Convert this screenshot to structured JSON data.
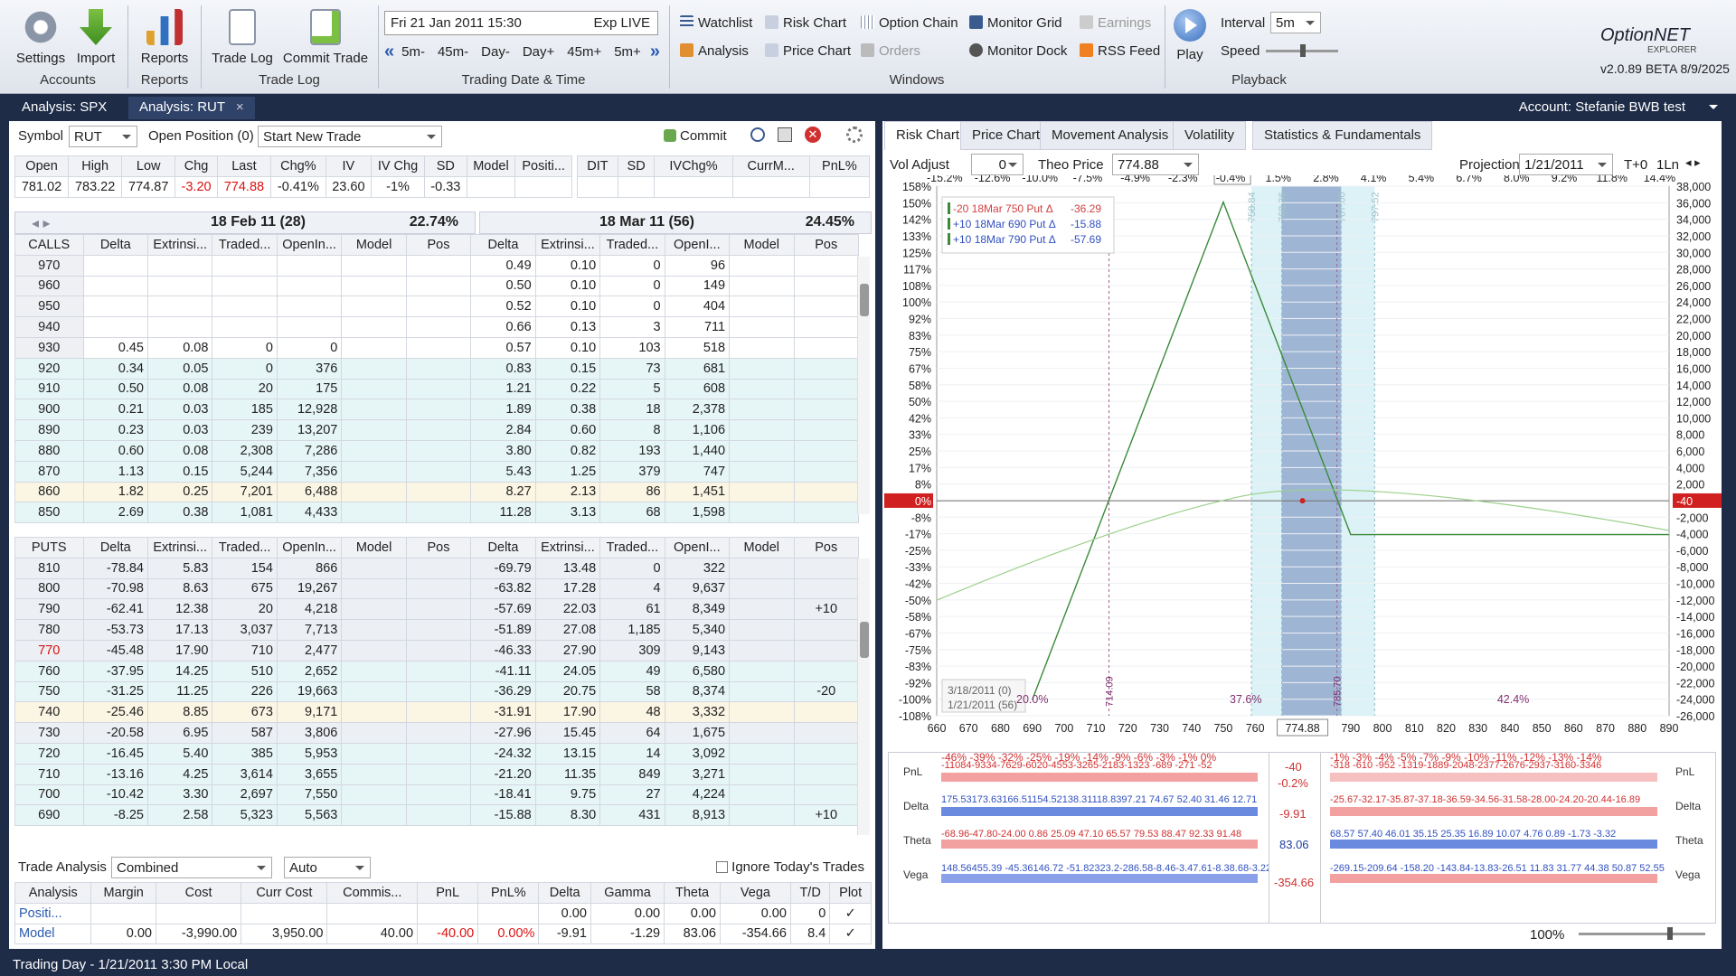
{
  "ribbon": {
    "settings": "Settings",
    "import": "Import",
    "reports": "Reports",
    "trade_log": "Trade Log",
    "commit_trade": "Commit Trade",
    "groups": {
      "accounts": "Accounts",
      "reports": "Reports",
      "trade_log": "Trade Log",
      "trading_date": "Trading Date & Time",
      "windows": "Windows",
      "playback": "Playback"
    },
    "date": "Fri 21 Jan 2011 15:30",
    "exp": "Exp LIVE",
    "nav": [
      "5m-",
      "45m-",
      "Day-",
      "Day+",
      "45m+",
      "5m+"
    ],
    "windows": {
      "watchlist": "Watchlist",
      "risk_chart": "Risk Chart",
      "option_chain": "Option Chain",
      "monitor_grid": "Monitor Grid",
      "earnings": "Earnings",
      "analysis": "Analysis",
      "price_chart": "Price Chart",
      "orders": "Orders",
      "monitor_dock": "Monitor Dock",
      "rss_feed": "RSS Feed"
    },
    "play": "Play",
    "interval_label": "Interval",
    "interval": "5m",
    "speed_label": "Speed",
    "logo": "OptionNET",
    "logo_sub": "EXPLORER",
    "version": "v2.0.89 BETA 8/9/2025"
  },
  "tabs": [
    {
      "label": "Analysis: SPX"
    },
    {
      "label": "Analysis: RUT",
      "close": "×"
    }
  ],
  "account": "Account: Stefanie BWB test",
  "symbol": {
    "label": "Symbol",
    "value": "RUT",
    "open_position": "Open Position (0)",
    "trade": "Start New Trade",
    "commit": "Commit"
  },
  "quote": {
    "headers": [
      "Open",
      "High",
      "Low",
      "Chg",
      "Last",
      "Chg%",
      "IV",
      "IV Chg",
      "SD",
      "Model",
      "Positi..."
    ],
    "values": [
      "781.02",
      "783.22",
      "774.87",
      "-3.20",
      "774.88",
      "-0.41%",
      "23.60",
      "-1%",
      "-0.33",
      "",
      ""
    ],
    "pos_headers": [
      "DIT",
      "SD",
      "IVChg%",
      "CurrM...",
      "PnL%"
    ]
  },
  "chain": {
    "exp1": {
      "title": "18 Feb 11 (28)",
      "iv": "22.74%"
    },
    "exp2": {
      "title": "18 Mar 11 (56)",
      "iv": "24.45%"
    },
    "cols": [
      "Delta",
      "Extrinsi...",
      "Traded...",
      "OpenIn...",
      "Model",
      "Pos"
    ],
    "cols2": [
      "Delta",
      "Extrinsi...",
      "Traded...",
      "OpenI...",
      "Model",
      "Pos"
    ],
    "calls_label": "CALLS",
    "puts_label": "PUTS",
    "calls": [
      [
        "970",
        "",
        "",
        "",
        "",
        "",
        "",
        "0.49",
        "0.10",
        "0",
        "96",
        "",
        ""
      ],
      [
        "960",
        "",
        "",
        "",
        "",
        "",
        "",
        "0.50",
        "0.10",
        "0",
        "149",
        "",
        ""
      ],
      [
        "950",
        "",
        "",
        "",
        "",
        "",
        "",
        "0.52",
        "0.10",
        "0",
        "404",
        "",
        ""
      ],
      [
        "940",
        "",
        "",
        "",
        "",
        "",
        "",
        "0.66",
        "0.13",
        "3",
        "711",
        "",
        ""
      ],
      [
        "930",
        "0.45",
        "0.08",
        "0",
        "0",
        "",
        "",
        "0.57",
        "0.10",
        "103",
        "518",
        "",
        ""
      ],
      [
        "920",
        "0.34",
        "0.05",
        "0",
        "376",
        "",
        "",
        "0.83",
        "0.15",
        "73",
        "681",
        "",
        ""
      ],
      [
        "910",
        "0.50",
        "0.08",
        "20",
        "175",
        "",
        "",
        "1.21",
        "0.22",
        "5",
        "608",
        "",
        ""
      ],
      [
        "900",
        "0.21",
        "0.03",
        "185",
        "12,928",
        "",
        "",
        "1.89",
        "0.38",
        "18",
        "2,378",
        "",
        ""
      ],
      [
        "890",
        "0.23",
        "0.03",
        "239",
        "13,207",
        "",
        "",
        "2.84",
        "0.60",
        "8",
        "1,106",
        "",
        ""
      ],
      [
        "880",
        "0.60",
        "0.08",
        "2,308",
        "7,286",
        "",
        "",
        "3.80",
        "0.82",
        "193",
        "1,440",
        "",
        ""
      ],
      [
        "870",
        "1.13",
        "0.15",
        "5,244",
        "7,356",
        "",
        "",
        "5.43",
        "1.25",
        "379",
        "747",
        "",
        ""
      ],
      [
        "860",
        "1.82",
        "0.25",
        "7,201",
        "6,488",
        "",
        "",
        "8.27",
        "2.13",
        "86",
        "1,451",
        "",
        ""
      ],
      [
        "850",
        "2.69",
        "0.38",
        "1,081",
        "4,433",
        "",
        "",
        "11.28",
        "3.13",
        "68",
        "1,598",
        "",
        ""
      ]
    ],
    "puts": [
      [
        "810",
        "-78.84",
        "5.83",
        "154",
        "866",
        "",
        "",
        "-69.79",
        "13.48",
        "0",
        "322",
        "",
        ""
      ],
      [
        "800",
        "-70.98",
        "8.63",
        "675",
        "19,267",
        "",
        "",
        "-63.82",
        "17.28",
        "4",
        "9,637",
        "",
        ""
      ],
      [
        "790",
        "-62.41",
        "12.38",
        "20",
        "4,218",
        "",
        "",
        "-57.69",
        "22.03",
        "61",
        "8,349",
        "",
        "+10"
      ],
      [
        "780",
        "-53.73",
        "17.13",
        "3,037",
        "7,713",
        "",
        "",
        "-51.89",
        "27.08",
        "1,185",
        "5,340",
        "",
        ""
      ],
      [
        "770",
        "-45.48",
        "17.90",
        "710",
        "2,477",
        "",
        "",
        "-46.33",
        "27.90",
        "309",
        "9,143",
        "",
        ""
      ],
      [
        "760",
        "-37.95",
        "14.25",
        "510",
        "2,652",
        "",
        "",
        "-41.11",
        "24.05",
        "49",
        "6,580",
        "",
        ""
      ],
      [
        "750",
        "-31.25",
        "11.25",
        "226",
        "19,663",
        "",
        "",
        "-36.29",
        "20.75",
        "58",
        "8,374",
        "",
        "-20"
      ],
      [
        "740",
        "-25.46",
        "8.85",
        "673",
        "9,171",
        "",
        "",
        "-31.91",
        "17.90",
        "48",
        "3,332",
        "",
        ""
      ],
      [
        "730",
        "-20.58",
        "6.95",
        "587",
        "3,806",
        "",
        "",
        "-27.96",
        "15.45",
        "64",
        "1,675",
        "",
        ""
      ],
      [
        "720",
        "-16.45",
        "5.40",
        "385",
        "5,953",
        "",
        "",
        "-24.32",
        "13.15",
        "14",
        "3,092",
        "",
        ""
      ],
      [
        "710",
        "-13.16",
        "4.25",
        "3,614",
        "3,655",
        "",
        "",
        "-21.20",
        "11.35",
        "849",
        "3,271",
        "",
        ""
      ],
      [
        "700",
        "-10.42",
        "3.30",
        "2,697",
        "7,550",
        "",
        "",
        "-18.41",
        "9.75",
        "27",
        "4,224",
        "",
        ""
      ],
      [
        "690",
        "-8.25",
        "2.58",
        "5,323",
        "5,563",
        "",
        "",
        "-15.88",
        "8.30",
        "431",
        "8,913",
        "",
        "+10"
      ]
    ]
  },
  "trade_analysis": {
    "label": "Trade Analysis",
    "mode": "Combined",
    "auto": "Auto",
    "ignore": "Ignore Today's Trades",
    "headers": [
      "Analysis",
      "Margin",
      "Cost",
      "Curr Cost",
      "Commis...",
      "PnL",
      "PnL%",
      "Delta",
      "Gamma",
      "Theta",
      "Vega",
      "T/D",
      "Plot"
    ],
    "rows": [
      [
        "Positi...",
        "",
        "",
        "",
        "",
        "",
        "",
        "0.00",
        "0.00",
        "0.00",
        "0.00",
        "0",
        "✓"
      ],
      [
        "Model",
        "0.00",
        "-3,990.00",
        "3,950.00",
        "40.00",
        "-40.00",
        "0.00%",
        "-9.91",
        "-1.29",
        "83.06",
        "-354.66",
        "8.4",
        "✓"
      ]
    ]
  },
  "right_tabs": [
    "Risk Chart",
    "Price Chart",
    "Movement Analysis",
    "Volatility",
    "Statistics & Fundamentals"
  ],
  "risk": {
    "vol_adjust_label": "Vol Adjust",
    "vol_adjust": "0",
    "theo_label": "Theo Price",
    "theo": "774.88",
    "projection_label": "Projection",
    "projection": "1/21/2011",
    "t0": "T+0",
    "ln": "1Ln",
    "top_pct": [
      "-15.2%",
      "-12.6%",
      "-10.0%",
      "-7.5%",
      "-4.9%",
      "-2.3%",
      "-0.4%",
      "1.5%",
      "2.8%",
      "4.1%",
      "5.4%",
      "6.7%",
      "8.0%",
      "9.2%",
      "11.8%",
      "14.4%"
    ],
    "left_pct": [
      "158%",
      "150%",
      "142%",
      "133%",
      "125%",
      "117%",
      "108%",
      "100%",
      "92%",
      "83%",
      "75%",
      "67%",
      "58%",
      "50%",
      "42%",
      "33%",
      "25%",
      "17%",
      "8%",
      "0%",
      "-8%",
      "-17%",
      "-25%",
      "-33%",
      "-42%",
      "-50%",
      "-58%",
      "-67%",
      "-75%",
      "-83%",
      "-92%",
      "-100%",
      "-108%"
    ],
    "right_val": [
      "38,000",
      "36,000",
      "34,000",
      "32,000",
      "30,000",
      "28,000",
      "26,000",
      "24,000",
      "22,000",
      "20,000",
      "18,000",
      "16,000",
      "14,000",
      "12,000",
      "10,000",
      "8,000",
      "6,000",
      "4,000",
      "2,000",
      "-40",
      "-2,000",
      "-4,000",
      "-6,000",
      "-8,000",
      "-10,000",
      "-12,000",
      "-14,000",
      "-16,000",
      "-18,000",
      "-20,000",
      "-22,000",
      "-24,000",
      "-26,000"
    ],
    "x_ticks": [
      "660",
      "670",
      "680",
      "690",
      "700",
      "710",
      "720",
      "730",
      "740",
      "750",
      "760",
      "774.88",
      "790",
      "800",
      "810",
      "820",
      "830",
      "840",
      "850",
      "860",
      "870",
      "880",
      "890"
    ],
    "legend": [
      {
        "text": "-20 18Mar 750 Put Δ",
        "val": "-36.29",
        "color": "#d04040"
      },
      {
        "text": "+10 18Mar 690 Put Δ",
        "val": "-15.88",
        "color": "#3050c0"
      },
      {
        "text": "+10 18Mar 790 Put Δ",
        "val": "-57.69",
        "color": "#3050c0"
      }
    ],
    "vlines": [
      "758.84",
      "768.36",
      "787.00",
      "797.52",
      "714.09",
      "785.70"
    ],
    "bottom_labels": [
      "20.0%",
      "37.6%",
      "42.4%"
    ],
    "date_legend": [
      "3/18/2011 (0)",
      "1/21/2011 (56)"
    ],
    "zero_left": "0%",
    "zero_right": "-40",
    "summary": {
      "pnl_label": "PnL",
      "delta_label": "Delta",
      "theta_label": "Theta",
      "vega_label": "Vega",
      "pnl_pct_left": "-46% -39% -32% -25% -19% -14% -9% -6% -3% -1% 0%",
      "pnl_pct_right": "-1% -3% -4% -5% -7% -9% -10% -11% -12% -13% -14%",
      "pnl_left": "-11084-9334-7629-6020-4553-3265-2183-1323 -689 -271 -52",
      "pnl_right": "-318 -610 -952 -1319-1889-2048-2377-2676-2937-3160-3346",
      "center_pnl": "-40",
      "center_pct": "-0.2%",
      "center_delta": "-9.91",
      "center_theta": "83.06",
      "center_vega": "-354.66",
      "delta_left": "175.53173.63166.51154.52138.31118.8397.21 74.67 52.40 31.46 12.71",
      "delta_right": "-25.67-32.17-35.87-37.18-36.59-34.56-31.58-28.00-24.20-20.44-16.89",
      "theta_left": "-68.96-47.80-24.00   0.86 25.09 47.10 65.57 79.53 88.47 92.33 91.48",
      "theta_right": "68.57 57.40 46.01 35.15 25.35 16.89 10.07 4.76 0.89  -1.73 -3.32",
      "vega_left": "148.56455.39 -45.36146.72 -51.82323.2-286.58-8.46-3.47.61-8.38.68-3.22.68",
      "vega_right": "-269.15-209.64 -158.20 -143.84-13.83-26.51  11.83 31.77 44.38 50.87 52.55"
    },
    "zoom": "100%"
  },
  "status": "Trading Day - 1/21/2011 3:30 PM Local"
}
